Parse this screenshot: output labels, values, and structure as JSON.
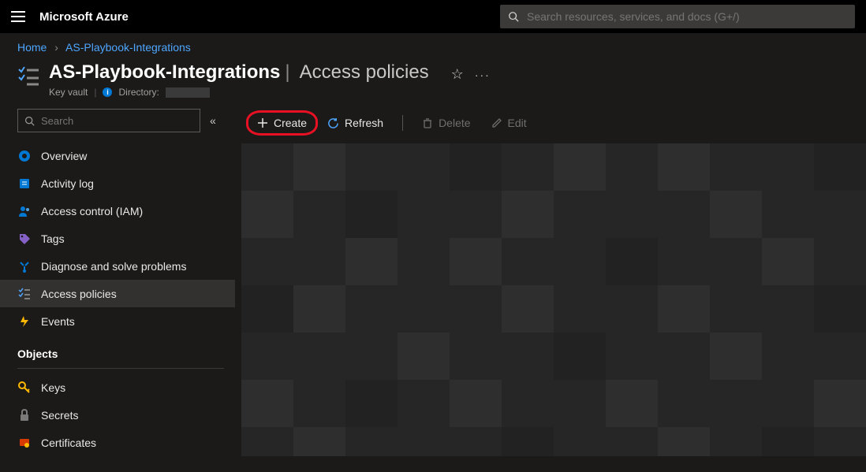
{
  "topbar": {
    "brand": "Microsoft Azure",
    "search_placeholder": "Search resources, services, and docs (G+/)"
  },
  "breadcrumb": {
    "home": "Home",
    "current": "AS-Playbook-Integrations"
  },
  "header": {
    "resource_name": "AS-Playbook-Integrations",
    "section": "Access policies",
    "resource_type": "Key vault",
    "directory_label": "Directory:"
  },
  "sidebar": {
    "search_placeholder": "Search",
    "items": [
      {
        "label": "Overview"
      },
      {
        "label": "Activity log"
      },
      {
        "label": "Access control (IAM)"
      },
      {
        "label": "Tags"
      },
      {
        "label": "Diagnose and solve problems"
      },
      {
        "label": "Access policies"
      },
      {
        "label": "Events"
      }
    ],
    "section_objects": "Objects",
    "objects": [
      {
        "label": "Keys"
      },
      {
        "label": "Secrets"
      },
      {
        "label": "Certificates"
      }
    ]
  },
  "toolbar": {
    "create": "Create",
    "refresh": "Refresh",
    "delete": "Delete",
    "edit": "Edit"
  }
}
